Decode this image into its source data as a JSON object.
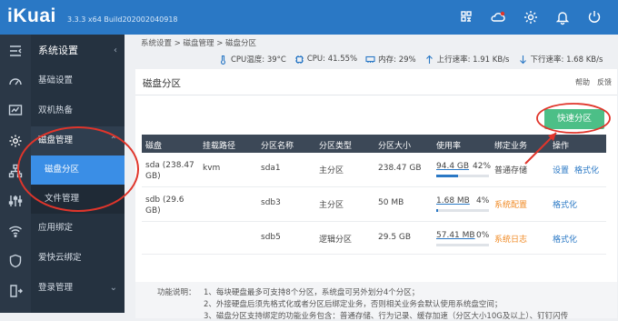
{
  "app": {
    "logo": "iKuai",
    "version": "3.3.3 x64 Build202002040918"
  },
  "topbar": {
    "icons": [
      "qrcode-icon",
      "cloud-alert-icon",
      "gear-icon",
      "bell-icon",
      "power-icon"
    ]
  },
  "rail": {
    "icons": [
      "menu-collapse-icon",
      "dashboard-icon",
      "monitor-chart-icon",
      "gear-icon",
      "network-icon",
      "sliders-icon",
      "wifi-icon",
      "shield-icon",
      "logout-icon"
    ]
  },
  "nav": {
    "section": "系统设置",
    "items": [
      {
        "label": "基础设置"
      },
      {
        "label": "双机热备"
      },
      {
        "label": "磁盘管理"
      },
      {
        "label": "磁盘分区"
      },
      {
        "label": "文件管理"
      },
      {
        "label": "应用绑定"
      },
      {
        "label": "爱快云绑定"
      },
      {
        "label": "登录管理"
      }
    ]
  },
  "breadcrumb": "系统设置 > 磁盘管理 > 磁盘分区",
  "status": {
    "cpu_temp": "CPU温度: 39°C",
    "cpu": "CPU: 41.55%",
    "memory": "内存: 29%",
    "upload": "上行速率: 1.91 KB/s",
    "download": "下行速率: 1.68 KB/s"
  },
  "panel": {
    "title": "磁盘分区",
    "help": "帮助",
    "feedback": "反馈",
    "quick_partition": "快速分区"
  },
  "table": {
    "headers": [
      "磁盘",
      "挂载路径",
      "分区名称",
      "分区类型",
      "分区大小",
      "使用率",
      "绑定业务",
      "操作"
    ],
    "rows": [
      {
        "disk": "sda (238.47 GB)",
        "mount": "kvm",
        "name": "sda1",
        "type": "主分区",
        "size": "238.47 GB",
        "used": "94.4 GB",
        "percent": "42%",
        "fill": 0.42,
        "service": "普通存储",
        "actions": [
          "设置",
          "格式化"
        ]
      },
      {
        "disk": "sdb (29.6 GB)",
        "mount": "",
        "name": "sdb3",
        "type": "主分区",
        "size": "50 MB",
        "used": "1.68 MB",
        "percent": "4%",
        "fill": 0.04,
        "service": "系统配置",
        "actions": [
          "格式化"
        ]
      },
      {
        "disk": "",
        "mount": "",
        "name": "sdb5",
        "type": "逻辑分区",
        "size": "29.5 GB",
        "used": "57.41 MB",
        "percent": "0%",
        "fill": 0.0,
        "service": "系统日志",
        "actions": [
          "格式化"
        ]
      }
    ]
  },
  "notes": {
    "label": "功能说明：",
    "lines": [
      "1、每块硬盘最多可支持8个分区，系统盘可另外划分4个分区；",
      "2、外接硬盘后须先格式化或者分区后绑定业务，否则相关业务会默认使用系统盘空间；",
      "3、磁盘分区支持绑定的功能业务包含：普通存储、行为记录、缓存加速（分区大小10G及以上）、钉钉闪传"
    ]
  },
  "colors": {
    "topbar": "#2a78c5",
    "sidebar": "#253240",
    "active": "#3a8ee6",
    "button": "#4cbf87",
    "annotation": "#e0352b"
  }
}
